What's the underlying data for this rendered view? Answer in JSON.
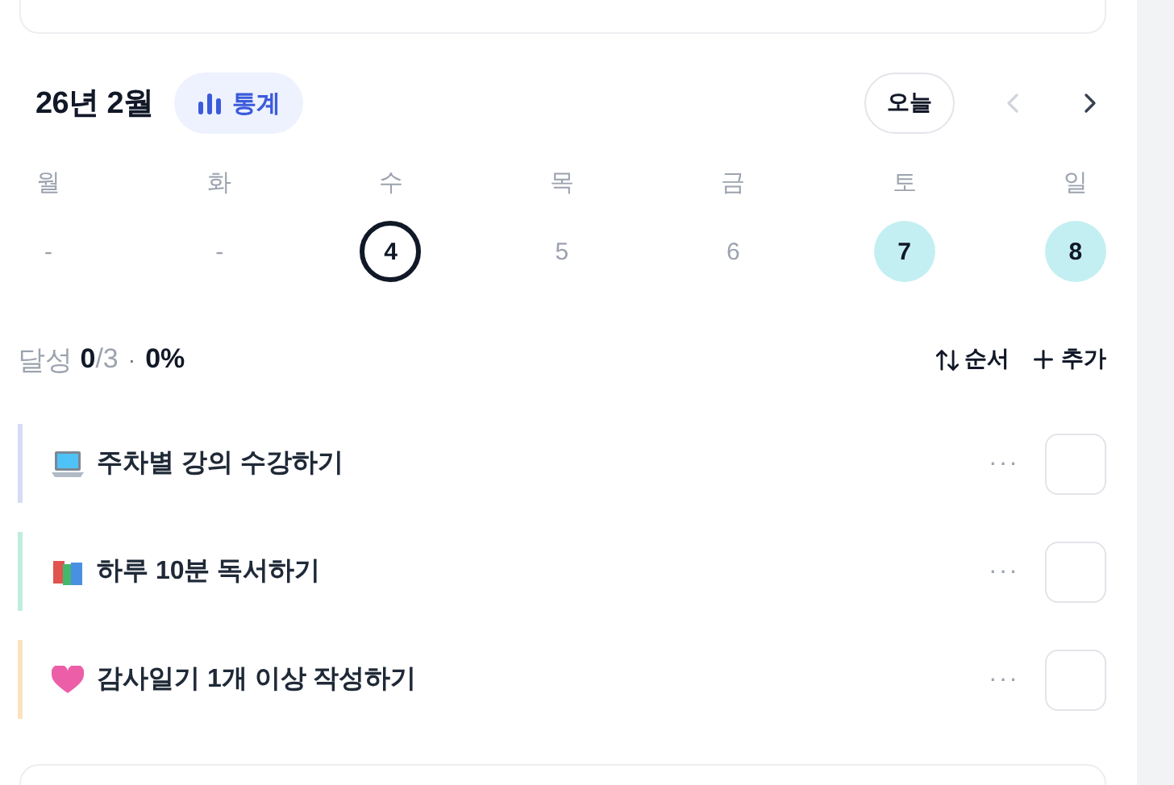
{
  "header": {
    "title": "26년 2월",
    "stats_button": "통계",
    "today_button": "오늘",
    "prev_disabled": true
  },
  "week": [
    {
      "weekday": "월",
      "date": "-",
      "today": false,
      "done": false
    },
    {
      "weekday": "화",
      "date": "-",
      "today": false,
      "done": false
    },
    {
      "weekday": "수",
      "date": "4",
      "today": true,
      "done": false
    },
    {
      "weekday": "목",
      "date": "5",
      "today": false,
      "done": false
    },
    {
      "weekday": "금",
      "date": "6",
      "today": false,
      "done": false
    },
    {
      "weekday": "토",
      "date": "7",
      "today": false,
      "done": true
    },
    {
      "weekday": "일",
      "date": "8",
      "today": false,
      "done": true
    }
  ],
  "summary": {
    "label": "달성",
    "done": "0",
    "total": "/3",
    "separator": "·",
    "percent": "0%",
    "sort_button": "순서",
    "add_button": "추가"
  },
  "habits": [
    {
      "title": "주차별 강의 수강하기",
      "kind": "laptop",
      "color": "#d6dcf5",
      "more": "···",
      "checked": false
    },
    {
      "title": "하루 10분 독서하기",
      "kind": "books",
      "color": "#bfeedd",
      "more": "···",
      "checked": false
    },
    {
      "title": "감사일기 1개 이상 작성하기",
      "kind": "heart",
      "color": "#fbe2bf",
      "more": "···",
      "checked": false
    }
  ]
}
